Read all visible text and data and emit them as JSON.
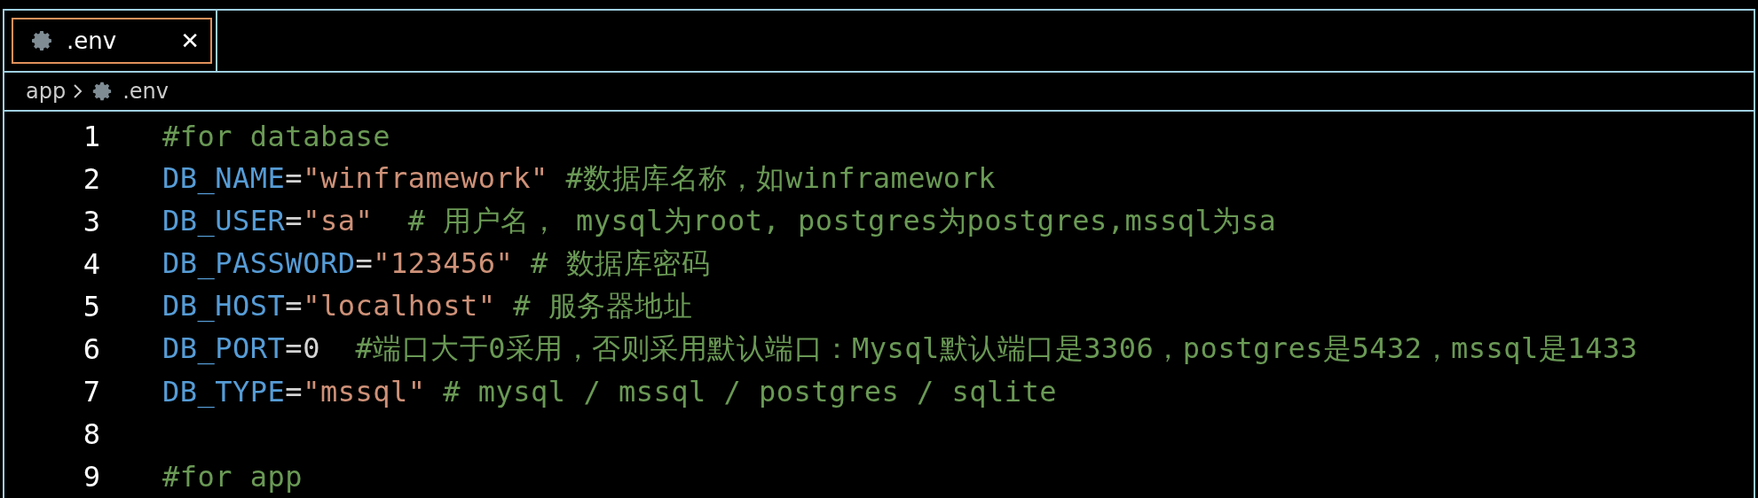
{
  "tabs": [
    {
      "label": ".env",
      "selected": true,
      "close": "✕"
    }
  ],
  "breadcrumb": [
    {
      "label": "app",
      "icon": false
    },
    {
      "label": ".env",
      "icon": true
    }
  ],
  "lines": [
    {
      "number": "1",
      "tokens": [
        {
          "kind": "comment",
          "text": "#for database"
        }
      ]
    },
    {
      "number": "2",
      "tokens": [
        {
          "kind": "key",
          "text": "DB_NAME"
        },
        {
          "kind": "op",
          "text": "="
        },
        {
          "kind": "string",
          "text": "\"winframework\""
        },
        {
          "kind": "comment",
          "text": " #数据库名称，如winframework"
        }
      ]
    },
    {
      "number": "3",
      "tokens": [
        {
          "kind": "key",
          "text": "DB_USER"
        },
        {
          "kind": "op",
          "text": "="
        },
        {
          "kind": "string",
          "text": "\"sa\""
        },
        {
          "kind": "comment",
          "text": "  # 用户名， mysql为root, postgres为postgres,mssql为sa"
        }
      ]
    },
    {
      "number": "4",
      "tokens": [
        {
          "kind": "key",
          "text": "DB_PASSWORD"
        },
        {
          "kind": "op",
          "text": "="
        },
        {
          "kind": "string",
          "text": "\"123456\""
        },
        {
          "kind": "comment",
          "text": " # 数据库密码"
        }
      ]
    },
    {
      "number": "5",
      "tokens": [
        {
          "kind": "key",
          "text": "DB_HOST"
        },
        {
          "kind": "op",
          "text": "="
        },
        {
          "kind": "string",
          "text": "\"localhost\""
        },
        {
          "kind": "comment",
          "text": " # 服务器地址"
        }
      ]
    },
    {
      "number": "6",
      "tokens": [
        {
          "kind": "key",
          "text": "DB_PORT"
        },
        {
          "kind": "op",
          "text": "=0"
        },
        {
          "kind": "comment",
          "text": "  #端口大于0采用，否则采用默认端口：Mysql默认端口是3306，postgres是5432，mssql是1433"
        }
      ]
    },
    {
      "number": "7",
      "tokens": [
        {
          "kind": "key",
          "text": "DB_TYPE"
        },
        {
          "kind": "op",
          "text": "="
        },
        {
          "kind": "string",
          "text": "\"mssql\""
        },
        {
          "kind": "comment",
          "text": " # mysql / mssql / postgres / sqlite"
        }
      ]
    },
    {
      "number": "8"
    },
    {
      "number": "9",
      "tokens": [
        {
          "kind": "comment",
          "text": "#for app"
        }
      ]
    }
  ]
}
